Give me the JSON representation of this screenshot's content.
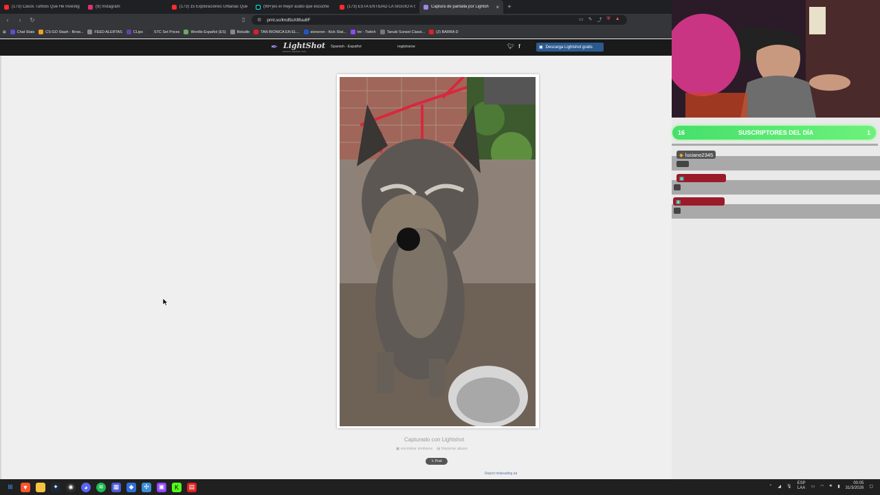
{
  "tabs": [
    {
      "title": "(173) Casos Turbios Que He Investig",
      "color": "#ff2b2b"
    },
    {
      "title": "(9) Instagram",
      "color": "#e1306c"
    },
    {
      "title": "(173) 15 Exploraciones Urbanas Que",
      "color": "#ff2b2b"
    },
    {
      "title": "(99+)es el mejor audio que escuche",
      "color": "#111111"
    },
    {
      "title": "(173) ESTA ENTIDAD LA SIGUIÓ A SU",
      "color": "#ff2b2b"
    },
    {
      "title": "Captura de pantalla por Lightsh",
      "color": "#a084e8",
      "active": true
    }
  ],
  "url": "prnt.sc/lmd5sX8fuu8F",
  "bookmarks": [
    {
      "label": "Chat Stats",
      "color": "#5b4bd6"
    },
    {
      "label": "CS:GO Stash - Brow...",
      "color": "#f0a020"
    },
    {
      "label": "FEED ALERTAS",
      "color": "#888888"
    },
    {
      "label": "CLips",
      "color": "#6441a5"
    },
    {
      "label": "STC Set Prices",
      "color": "#333333"
    },
    {
      "label": "Wordle Español (ES)",
      "color": "#6aaa64"
    },
    {
      "label": "Boludle",
      "color": "#888888"
    },
    {
      "label": "TAN BIONICA EN EL...",
      "color": "#e02020"
    },
    {
      "label": "sioneron - Kick Stat...",
      "color": "#2255cc"
    },
    {
      "label": "tnr - Twitch",
      "color": "#9146ff"
    },
    {
      "label": "Tanuki Sunset Classi...",
      "color": "#777777"
    },
    {
      "label": "(2) BARRA D",
      "color": "#e02020"
    }
  ],
  "lightshot": {
    "logo": "LightShot",
    "logo_sub": "screen capture tool",
    "language": "Spanish - Español",
    "register": "registrarse",
    "download": "Descarga Lightshot gratis",
    "captured": "Capturado con Lightshot",
    "similar": "encontrar similares",
    "report": "Reportar abuso",
    "post": "Post",
    "report_ad": "Report misleading ad"
  },
  "overlay": {
    "count": "16",
    "title": "SUSCRIPTORES DEL DÍA",
    "count_right": "1",
    "subs": [
      {
        "name": "luciano2345"
      },
      {
        "name": ""
      },
      {
        "name": ""
      }
    ]
  },
  "tray": {
    "lang": "ESP",
    "lang2": "LAA",
    "time": "00:05",
    "date": "31/3/2026"
  }
}
